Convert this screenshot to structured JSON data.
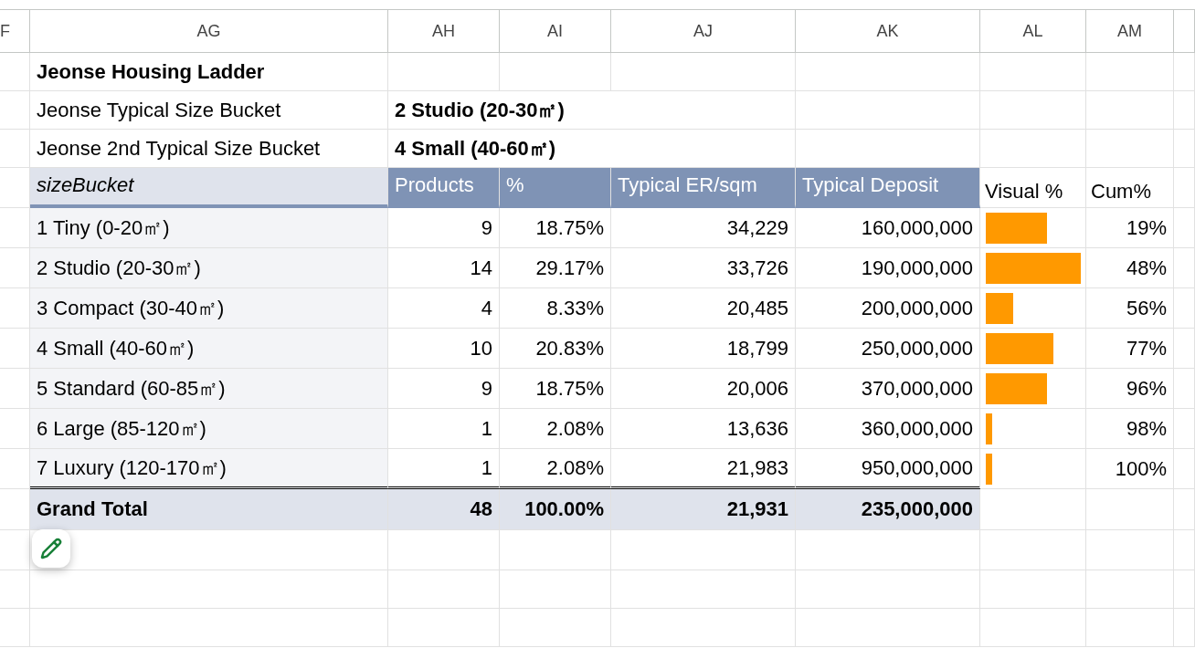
{
  "column_headers": [
    {
      "label": "F"
    },
    {
      "label": "AG"
    },
    {
      "label": "AH"
    },
    {
      "label": "AI"
    },
    {
      "label": "AJ"
    },
    {
      "label": "AK"
    },
    {
      "label": "AL"
    },
    {
      "label": "AM"
    }
  ],
  "title": "Jeonse Housing Ladder",
  "summary": [
    {
      "label": "Jeonse Typical Size Bucket",
      "value": "2 Studio (20-30㎡)"
    },
    {
      "label": "Jeonse 2nd Typical Size Bucket",
      "value": "4 Small (40-60㎡)"
    }
  ],
  "table": {
    "columns": [
      {
        "label": "sizeBucket",
        "kind": "dimension"
      },
      {
        "label": "Products",
        "kind": "measure"
      },
      {
        "label": "%",
        "kind": "measure"
      },
      {
        "label": "Typical ER/sqm",
        "kind": "measure"
      },
      {
        "label": "Typical Deposit",
        "kind": "measure"
      },
      {
        "label": "Visual %",
        "kind": "extra"
      },
      {
        "label": "Cum%",
        "kind": "extra"
      }
    ],
    "rows": [
      {
        "size_bucket": "1 Tiny (0-20㎡)",
        "products": "9",
        "percent": "18.75%",
        "er_sqm": "34,229",
        "deposit": "160,000,000",
        "level": 0.64,
        "cum": "19%"
      },
      {
        "size_bucket": "2 Studio (20-30㎡)",
        "products": "14",
        "percent": "29.17%",
        "er_sqm": "33,726",
        "deposit": "190,000,000",
        "level": 1.0,
        "cum": "48%"
      },
      {
        "size_bucket": "3 Compact (30-40㎡)",
        "products": "4",
        "percent": "8.33%",
        "er_sqm": "20,485",
        "deposit": "200,000,000",
        "level": 0.29,
        "cum": "56%"
      },
      {
        "size_bucket": "4 Small (40-60㎡)",
        "products": "10",
        "percent": "20.83%",
        "er_sqm": "18,799",
        "deposit": "250,000,000",
        "level": 0.71,
        "cum": "77%"
      },
      {
        "size_bucket": "5 Standard (60-85㎡)",
        "products": "9",
        "percent": "18.75%",
        "er_sqm": "20,006",
        "deposit": "370,000,000",
        "level": 0.64,
        "cum": "96%"
      },
      {
        "size_bucket": "6 Large (85-120㎡)",
        "products": "1",
        "percent": "2.08%",
        "er_sqm": "13,636",
        "deposit": "360,000,000",
        "level": 0.07,
        "cum": "98%"
      },
      {
        "size_bucket": "7 Luxury (120-170㎡)",
        "products": "1",
        "percent": "2.08%",
        "er_sqm": "21,983",
        "deposit": "950,000,000",
        "level": 0.07,
        "cum": "100%"
      }
    ],
    "total": {
      "label": "Grand Total",
      "products": "48",
      "percent": "100.00%",
      "er_sqm": "21,931",
      "deposit": "235,000,000"
    }
  }
}
